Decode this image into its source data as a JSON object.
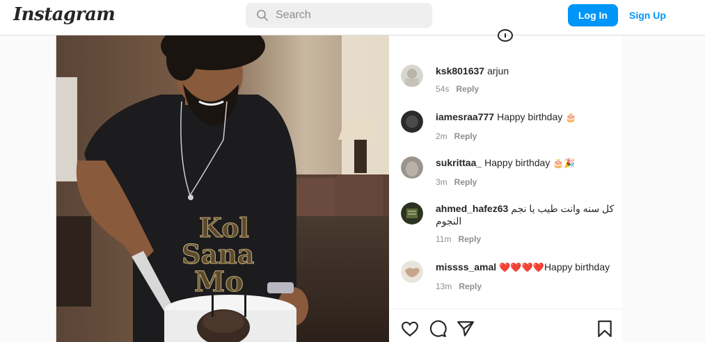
{
  "header": {
    "logo": "Instagram",
    "search_placeholder": "Search",
    "login_label": "Log In",
    "signup_label": "Sign Up"
  },
  "post": {
    "topper_words": [
      "Kol",
      "Sana",
      "Mo"
    ],
    "comments": [
      {
        "username": "ksk801637",
        "text": "arjun",
        "emoji": "",
        "time": "54s",
        "reply_label": "Reply"
      },
      {
        "username": "iamesraa777",
        "text": "Happy birthday",
        "emoji": "🎂",
        "time": "2m",
        "reply_label": "Reply"
      },
      {
        "username": "sukrittaa_",
        "text": "Happy birthday",
        "emoji": "🎂🎉",
        "time": "3m",
        "reply_label": "Reply"
      },
      {
        "username": "ahmed_hafez63",
        "text": "كل سنه وانت طيب يا نجم النجوم",
        "emoji": "",
        "time": "11m",
        "reply_label": "Reply"
      },
      {
        "username": "missss_amal",
        "text": "Happy birthday",
        "emoji": "❤️❤️❤️❤️",
        "time": "13m",
        "reply_label": "Reply"
      }
    ],
    "actions": [
      "heart-icon",
      "comment-icon",
      "share-icon",
      "bookmark-icon"
    ]
  },
  "colors": {
    "primary_blue": "#0095f6",
    "border": "#dbdbdb",
    "muted_text": "#8e8e8e",
    "heart_red": "#ed4956"
  }
}
